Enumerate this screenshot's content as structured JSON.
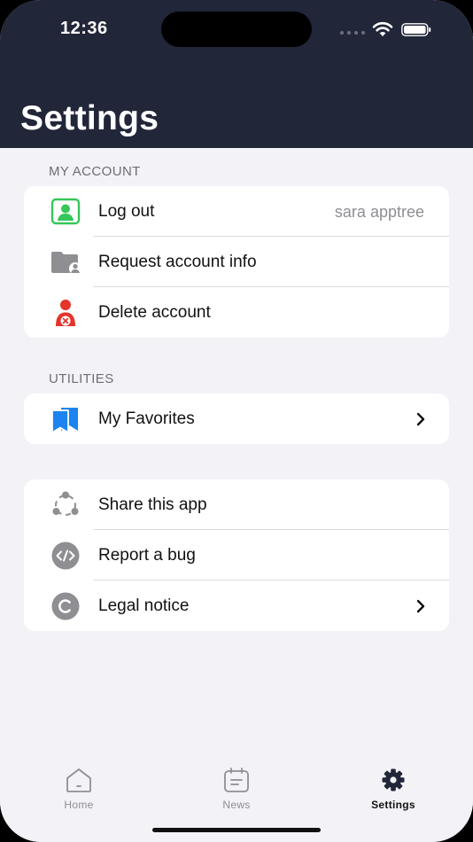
{
  "status_bar": {
    "time": "12:36"
  },
  "header": {
    "title": "Settings"
  },
  "sections": {
    "my_account": {
      "label": "MY ACCOUNT",
      "items": [
        {
          "icon": "user-badge-icon",
          "label": "Log out",
          "value": "sara apptree"
        },
        {
          "icon": "folder-user-icon",
          "label": "Request account info"
        },
        {
          "icon": "delete-user-icon",
          "label": "Delete account"
        }
      ]
    },
    "utilities": {
      "label": "UTILITIES",
      "items": [
        {
          "icon": "bookmarks-icon",
          "label": "My Favorites"
        }
      ]
    },
    "other": {
      "items": [
        {
          "icon": "share-icon",
          "label": "Share this app"
        },
        {
          "icon": "code-bug-icon",
          "label": "Report a bug"
        },
        {
          "icon": "copyright-icon",
          "label": "Legal notice"
        }
      ]
    }
  },
  "tabbar": {
    "tabs": [
      {
        "label": "Home",
        "icon": "home-icon"
      },
      {
        "label": "News",
        "icon": "news-icon"
      },
      {
        "label": "Settings",
        "icon": "gear-icon"
      }
    ]
  },
  "colors": {
    "header_bg": "#212639",
    "page_bg": "#f2f2f7",
    "green": "#34c759",
    "red": "#e5342b",
    "blue": "#1b84f0",
    "gray": "#8e8e93"
  }
}
